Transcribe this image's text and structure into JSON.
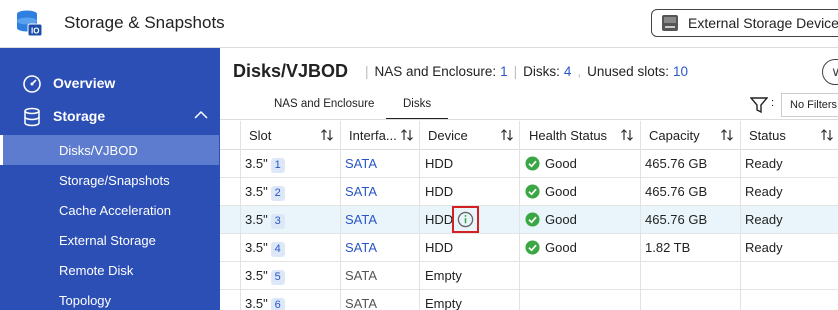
{
  "app": {
    "title": "Storage & Snapshots",
    "icon": "storage-app-icon",
    "external_button_label": "External Storage Devices"
  },
  "sidebar": {
    "main_items": [
      {
        "label": "Overview",
        "icon": "gauge-icon"
      },
      {
        "label": "Storage",
        "icon": "database-icon",
        "expanded": true
      }
    ],
    "sub_items": [
      {
        "label": "Disks/VJBOD",
        "active": true
      },
      {
        "label": "Storage/Snapshots"
      },
      {
        "label": "Cache Acceleration"
      },
      {
        "label": "External Storage"
      },
      {
        "label": "Remote Disk"
      },
      {
        "label": "Topology"
      }
    ]
  },
  "header": {
    "title": "Disks/VJBOD",
    "nas_label": "NAS and Enclosure:",
    "nas_count": "1",
    "disks_label": "Disks:",
    "disks_count": "4",
    "unused_label": "Unused slots:",
    "unused_count": "10"
  },
  "tabs": [
    {
      "label": "NAS and Enclosure",
      "active": false
    },
    {
      "label": "Disks",
      "active": true
    }
  ],
  "filter": {
    "colon": ":",
    "value": "No Filters"
  },
  "table": {
    "columns": [
      "Slot",
      "Interfa...",
      "Device",
      "Health Status",
      "Capacity",
      "Status"
    ],
    "rows": [
      {
        "slot": "3.5\"",
        "slot_num": "1",
        "interface": "SATA",
        "device": "HDD",
        "health": "Good",
        "capacity": "465.76 GB",
        "status": "Ready",
        "used": true
      },
      {
        "slot": "3.5\"",
        "slot_num": "2",
        "interface": "SATA",
        "device": "HDD",
        "health": "Good",
        "capacity": "465.76 GB",
        "status": "Ready",
        "used": true
      },
      {
        "slot": "3.5\"",
        "slot_num": "3",
        "interface": "SATA",
        "device": "HDD",
        "health": "Good",
        "capacity": "465.76 GB",
        "status": "Ready",
        "used": true,
        "highlight": true
      },
      {
        "slot": "3.5\"",
        "slot_num": "4",
        "interface": "SATA",
        "device": "HDD",
        "health": "Good",
        "capacity": "1.82 TB",
        "status": "Ready",
        "used": true
      },
      {
        "slot": "3.5\"",
        "slot_num": "5",
        "interface": "SATA",
        "device": "Empty",
        "health": "",
        "capacity": "",
        "status": "",
        "used": false
      },
      {
        "slot": "3.5\"",
        "slot_num": "6",
        "interface": "SATA",
        "device": "Empty",
        "health": "",
        "capacity": "",
        "status": "",
        "used": false
      }
    ]
  },
  "colors": {
    "sidebar_bg": "#2b4fb5",
    "sidebar_active": "#5d7ccf",
    "link": "#2a56c6",
    "good": "#3aa744",
    "highlight_row": "#e9f5fa",
    "callout": "#d32020"
  }
}
